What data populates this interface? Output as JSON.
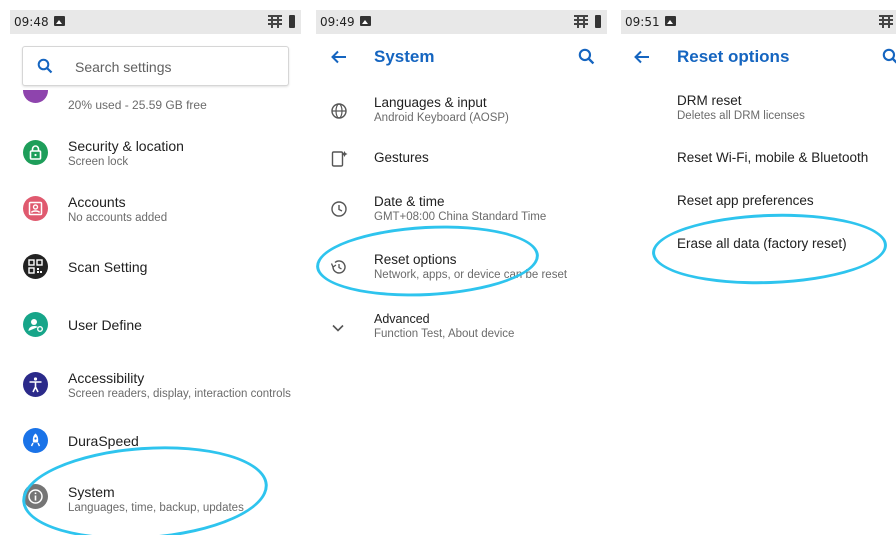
{
  "colors": {
    "accent": "#1565c0",
    "highlight": "#2ec4ee",
    "security": "#1e9e5a",
    "accounts": "#e05a6f",
    "scan": "#222222",
    "user": "#17a589",
    "accessibility": "#2b2a8a",
    "duraspeed": "#1a73e8",
    "system": "#757575"
  },
  "settings_panel": {
    "status_time": "09:48",
    "search_placeholder": "Search settings",
    "partial_item_sub": "20% used - 25.59 GB free",
    "items": [
      {
        "title": "Security & location",
        "subtitle": "Screen lock",
        "icon": "lock-icon"
      },
      {
        "title": "Accounts",
        "subtitle": "No accounts added",
        "icon": "account-box-icon"
      },
      {
        "title": "Scan Setting",
        "subtitle": "",
        "icon": "qr-scan-icon"
      },
      {
        "title": "User Define",
        "subtitle": "",
        "icon": "user-settings-icon"
      },
      {
        "title": "Accessibility",
        "subtitle": "Screen readers, display, interaction controls",
        "icon": "accessibility-icon"
      },
      {
        "title": "DuraSpeed",
        "subtitle": "",
        "icon": "rocket-icon"
      },
      {
        "title": "System",
        "subtitle": "Languages, time, backup, updates",
        "icon": "info-icon"
      }
    ]
  },
  "system_panel": {
    "status_time": "09:49",
    "title": "System",
    "items": [
      {
        "title": "Languages & input",
        "subtitle": "Android Keyboard (AOSP)",
        "icon": "globe-icon"
      },
      {
        "title": "Gestures",
        "subtitle": "",
        "icon": "gesture-phone-icon"
      },
      {
        "title": "Date & time",
        "subtitle": "GMT+08:00 China Standard Time",
        "icon": "clock-icon"
      },
      {
        "title": "Reset options",
        "subtitle": "Network, apps, or device can be reset",
        "icon": "restore-icon"
      },
      {
        "title": "Advanced",
        "subtitle": "Function Test, About device",
        "icon": "chevron-down-icon"
      }
    ]
  },
  "reset_panel": {
    "status_time": "09:51",
    "title": "Reset options",
    "items": [
      {
        "title": "DRM reset",
        "subtitle": "Deletes all DRM licenses"
      },
      {
        "title": "Reset Wi-Fi, mobile & Bluetooth",
        "subtitle": ""
      },
      {
        "title": "Reset app preferences",
        "subtitle": ""
      },
      {
        "title": "Erase all data (factory reset)",
        "subtitle": ""
      }
    ]
  }
}
